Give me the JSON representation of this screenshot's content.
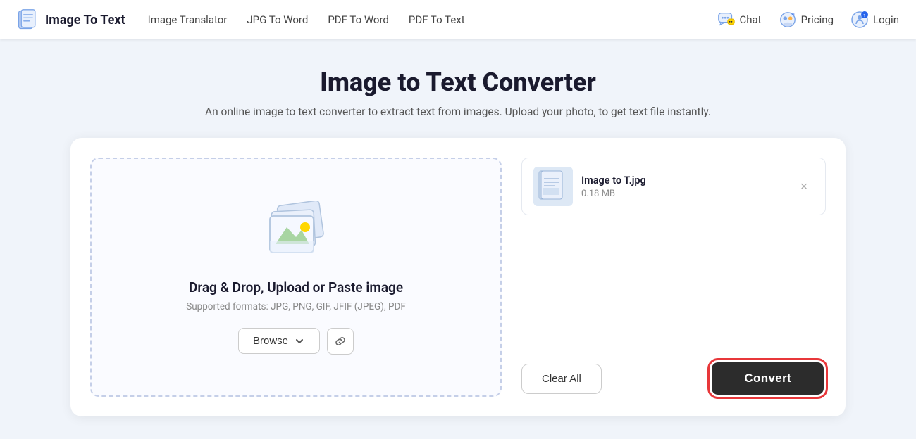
{
  "nav": {
    "logo_text": "Image To Text",
    "links": [
      {
        "label": "Image Translator",
        "id": "image-translator"
      },
      {
        "label": "JPG To Word",
        "id": "jpg-to-word"
      },
      {
        "label": "PDF To Word",
        "id": "pdf-to-word"
      },
      {
        "label": "PDF To Text",
        "id": "pdf-to-text"
      }
    ],
    "chat_label": "Chat",
    "pricing_label": "Pricing",
    "login_label": "Login"
  },
  "hero": {
    "title": "Image to Text Converter",
    "subtitle": "An online image to text converter to extract text from images. Upload your photo, to get text file instantly."
  },
  "dropzone": {
    "title": "Drag & Drop, Upload or Paste image",
    "subtitle": "Supported formats: JPG, PNG, GIF, JFIF (JPEG), PDF",
    "browse_label": "Browse"
  },
  "file": {
    "name": "Image to T.jpg",
    "size": "0.18 MB"
  },
  "actions": {
    "clear_all_label": "Clear All",
    "convert_label": "Convert"
  }
}
